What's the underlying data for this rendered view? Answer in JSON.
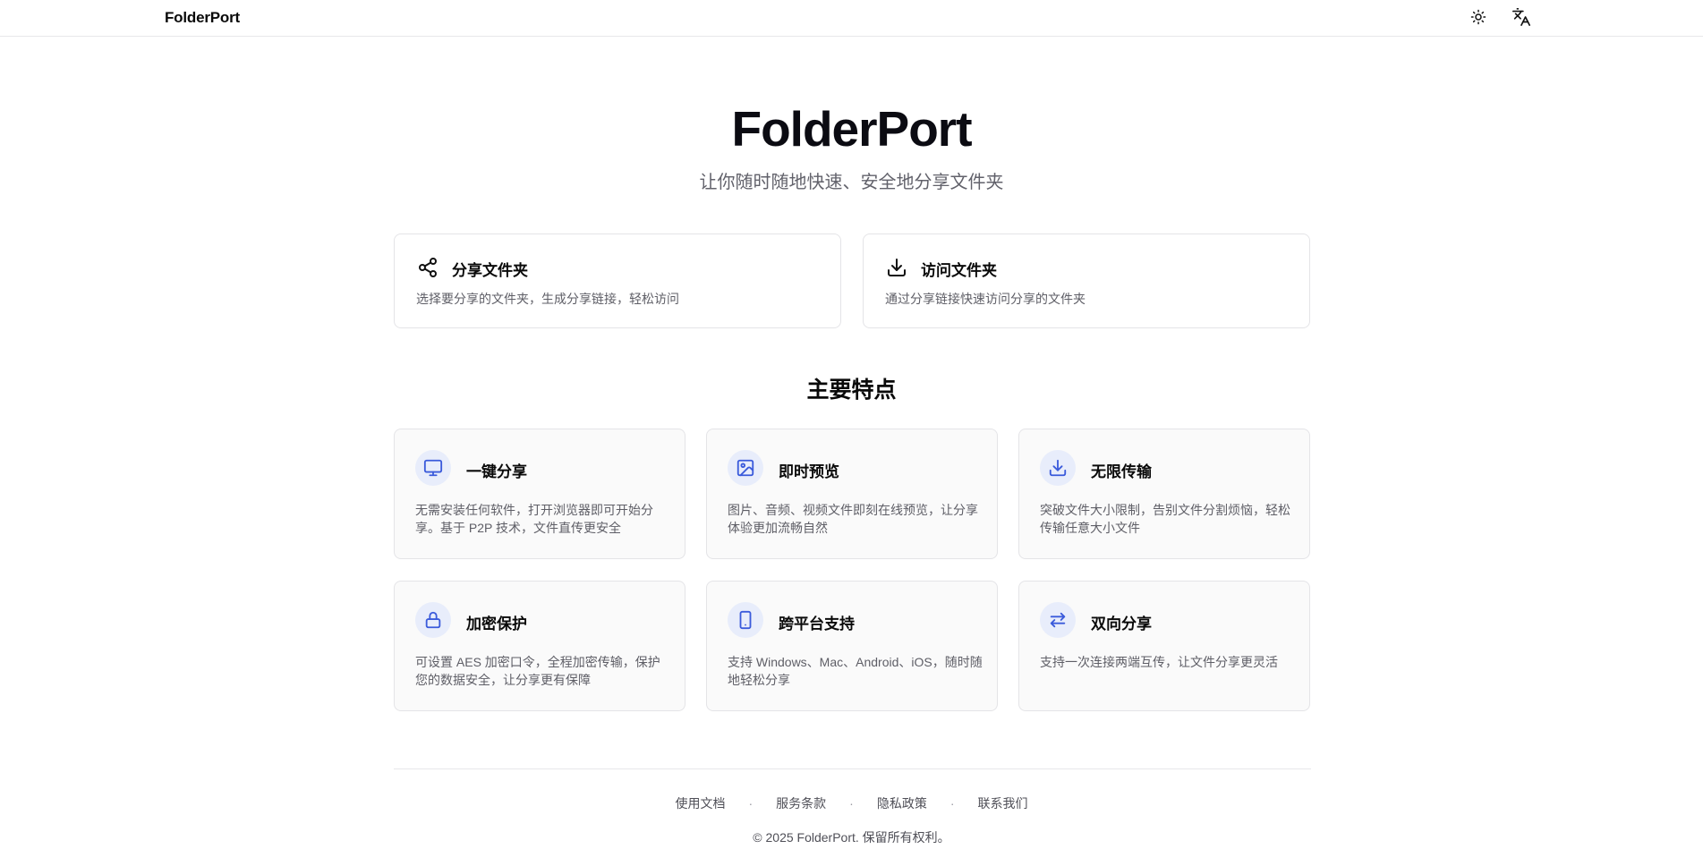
{
  "header": {
    "brand": "FolderPort",
    "theme_icon": "sun-icon",
    "language_icon": "translate-icon"
  },
  "hero": {
    "title": "FolderPort",
    "subtitle": "让你随时随地快速、安全地分享文件夹"
  },
  "actions": [
    {
      "icon": "share-icon",
      "title": "分享文件夹",
      "description": "选择要分享的文件夹，生成分享链接，轻松访问"
    },
    {
      "icon": "download-icon",
      "title": "访问文件夹",
      "description": "通过分享链接快速访问分享的文件夹"
    }
  ],
  "features": {
    "title": "主要特点",
    "items": [
      {
        "icon": "monitor-icon",
        "title": "一键分享",
        "description": "无需安装任何软件，打开浏览器即可开始分享。基于 P2P 技术，文件直传更安全"
      },
      {
        "icon": "image-icon",
        "title": "即时预览",
        "description": "图片、音频、视频文件即刻在线预览，让分享体验更加流畅自然"
      },
      {
        "icon": "download-icon",
        "title": "无限传输",
        "description": "突破文件大小限制，告别文件分割烦恼，轻松传输任意大小文件"
      },
      {
        "icon": "lock-icon",
        "title": "加密保护",
        "description": "可设置 AES 加密口令，全程加密传输，保护您的数据安全，让分享更有保障"
      },
      {
        "icon": "tablet-icon",
        "title": "跨平台支持",
        "description": "支持 Windows、Mac、Android、iOS，随时随地轻松分享"
      },
      {
        "icon": "arrows-swap-icon",
        "title": "双向分享",
        "description": "支持一次连接两端互传，让文件分享更灵活"
      }
    ]
  },
  "footer": {
    "links": [
      "使用文档",
      "服务条款",
      "隐私政策",
      "联系我们"
    ],
    "separator": "·",
    "copyright": "© 2025 FolderPort. 保留所有权利。"
  },
  "colors": {
    "accent": "#3b5bdb",
    "icon_bg": "#e8edfb",
    "card_bg": "#fafafa",
    "border": "#e4e4e7"
  }
}
